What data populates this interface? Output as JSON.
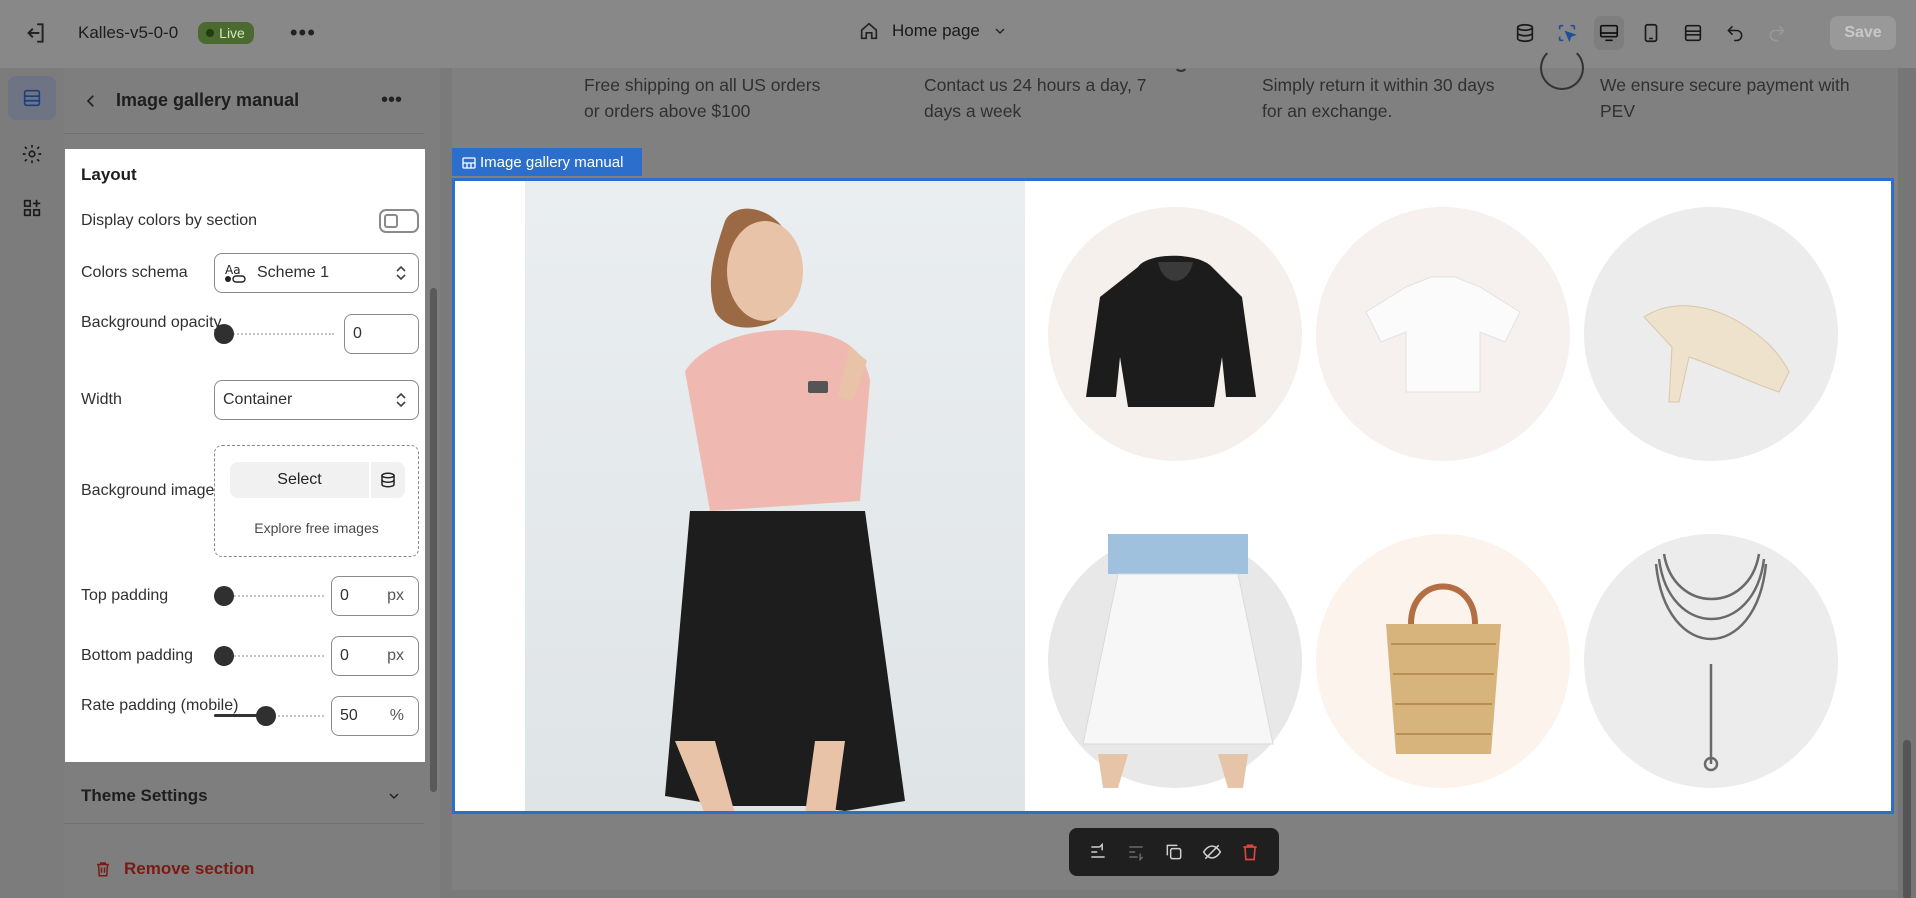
{
  "topbar": {
    "theme_name": "Kalles-v5-0-0",
    "status_badge": "Live",
    "page_selector": "Home page",
    "save_label": "Save"
  },
  "panel": {
    "title": "Image gallery manual",
    "layout_heading": "Layout",
    "display_colors_label": "Display colors by section",
    "display_colors_on": false,
    "colors_schema_label": "Colors schema",
    "colors_schema_value": "Scheme 1",
    "bg_opacity_label": "Background opacity",
    "bg_opacity_value": "0",
    "width_label": "Width",
    "width_value": "Container",
    "bg_image_label": "Background image",
    "select_label": "Select",
    "explore_label": "Explore free images",
    "top_padding_label": "Top padding",
    "top_padding_value": "0",
    "bottom_padding_label": "Bottom padding",
    "bottom_padding_value": "0",
    "rate_padding_label": "Rate padding (mobile)",
    "rate_padding_value": "50",
    "unit_px": "px",
    "unit_pct": "%",
    "theme_settings_label": "Theme Settings",
    "remove_section_label": "Remove section"
  },
  "preview": {
    "features": [
      "Free shipping on all US orders or orders above $100",
      "Contact us 24 hours a day, 7 days a week",
      "Simply return it within 30 days for an exchange.",
      "We ensure secure payment with PEV"
    ],
    "section_tag": "Image gallery manual",
    "products": [
      "black-jacket",
      "white-tshirt",
      "cream-heels",
      "white-skirt",
      "straw-tote-bag",
      "layered-necklace"
    ]
  },
  "colors": {
    "accent_blue": "#2c6ecb",
    "live_badge_bg": "#4a6a30",
    "remove_red": "#7a1a14"
  }
}
